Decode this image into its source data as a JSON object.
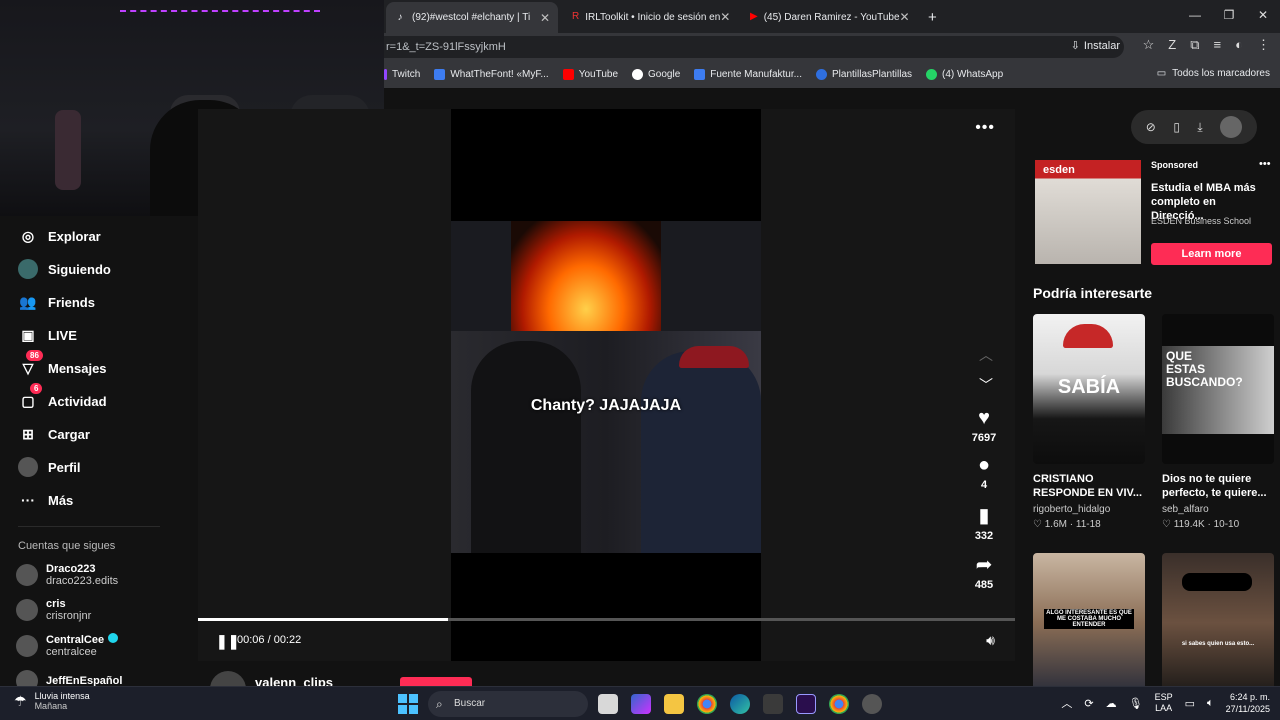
{
  "browser": {
    "tabs": [
      {
        "title": "(92)#westcol #elchanty | Ti",
        "favicon": "tiktok-icon"
      },
      {
        "title": "IRLToolkit • Inicio de sesión en",
        "favicon": "irltoolkit-icon"
      },
      {
        "title": "(45) Daren Ramirez - YouTube",
        "favicon": "youtube-icon"
      }
    ],
    "new_tab": "+",
    "url": "r=1&_t=ZS-91lFssyjkmH",
    "install_label": "Instalar",
    "bookmarks": [
      {
        "label": "Twitch",
        "color": "#9146ff"
      },
      {
        "label": "WhatTheFont! «MyF...",
        "color": "#3d7cf0"
      },
      {
        "label": "YouTube",
        "color": "#ff0000"
      },
      {
        "label": "Google",
        "color": "#ffffff"
      },
      {
        "label": "Fuente Manufaktur...",
        "color": "#3d7cf0"
      },
      {
        "label": "PlantillasPlantillas",
        "color": "#2f6fe0"
      },
      {
        "label": "(4) WhatsApp",
        "color": "#25d366"
      }
    ],
    "all_bookmarks": "Todos los marcadores"
  },
  "sidebar": {
    "items": [
      {
        "label": "Explorar",
        "icon": "compass-icon"
      },
      {
        "label": "Siguiendo",
        "icon": "following-avatar-icon"
      },
      {
        "label": "Friends",
        "icon": "friends-icon"
      },
      {
        "label": "LIVE",
        "icon": "live-icon"
      },
      {
        "label": "Mensajes",
        "icon": "messages-icon",
        "badge": "86"
      },
      {
        "label": "Actividad",
        "icon": "activity-icon",
        "badge": "6"
      },
      {
        "label": "Cargar",
        "icon": "upload-icon"
      },
      {
        "label": "Perfil",
        "icon": "profile-icon"
      },
      {
        "label": "Más",
        "icon": "more-icon"
      }
    ],
    "following_title": "Cuentas que sigues",
    "following": [
      {
        "name": "Draco223",
        "handle": "draco223.edits"
      },
      {
        "name": "cris",
        "handle": "crisronjnr"
      },
      {
        "name": "CentralCee",
        "handle": "centralcee",
        "verified": true
      },
      {
        "name": "JeffEnEspañol",
        "handle": ""
      }
    ]
  },
  "player": {
    "caption": "Chanty? JAJAJAJA",
    "likes": "7697",
    "comments": "4",
    "saves": "332",
    "shares": "485",
    "time": "00:06 / 00:22",
    "progress": 0.306,
    "author": "valenn_clips"
  },
  "right": {
    "sponsored": "Sponsored",
    "ad_title": "Estudia el MBA más completo en Direcció...",
    "ad_brand": "ESDEN Business School",
    "ad_logo": "esden",
    "ad_button": "Learn more",
    "rec_title": "Podría interesarte",
    "cards": [
      {
        "title": "CRISTIANO RESPONDE EN VIV...",
        "user": "rigoberto_hidalgo",
        "likes": "1.6M",
        "date": "11-18",
        "overlay": "SABÍA"
      },
      {
        "title": "Dios no te quiere perfecto, te quiere...",
        "user": "seb_alfaro",
        "likes": "119.4K",
        "date": "10-10",
        "overlay": "QUE ESTAS BUSCANDO?"
      },
      {
        "title": "",
        "user": "",
        "likes": "",
        "date": "",
        "overlay": "ALGO INTERESANTE ES QUE ME COSTABA MUCHO ENTENDER"
      },
      {
        "title": "",
        "user": "",
        "likes": "",
        "date": "",
        "overlay": "si sabes quien usa esto..."
      }
    ]
  },
  "taskbar": {
    "weather_title": "Lluvia intensa",
    "weather_sub": "Mañana",
    "search": "Buscar",
    "lang1": "ESP",
    "lang2": "LAA",
    "time": "6:24 p. m.",
    "date": "27/11/2025"
  }
}
